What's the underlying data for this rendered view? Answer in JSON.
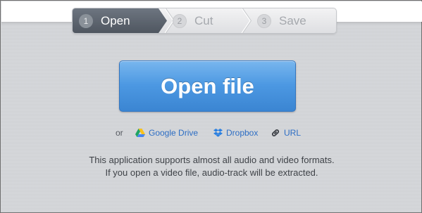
{
  "steps": [
    {
      "number": "1",
      "label": "Open",
      "active": true
    },
    {
      "number": "2",
      "label": "Cut",
      "active": false
    },
    {
      "number": "3",
      "label": "Save",
      "active": false
    }
  ],
  "open_button": {
    "label": "Open file"
  },
  "sources": {
    "or_label": "or",
    "google_drive": {
      "label": "Google Drive",
      "icon": "google-drive-icon"
    },
    "dropbox": {
      "label": "Dropbox",
      "icon": "dropbox-icon"
    },
    "url": {
      "label": "URL",
      "icon": "link-icon"
    }
  },
  "info": {
    "line1": "This application supports almost all audio and video formats.",
    "line2": "If you open a video file, audio-track will be extracted."
  },
  "colors": {
    "accent_blue": "#4c98e2",
    "link_blue": "#2d6ec4",
    "active_step": "#5a616b",
    "background": "#d3d5d9"
  }
}
